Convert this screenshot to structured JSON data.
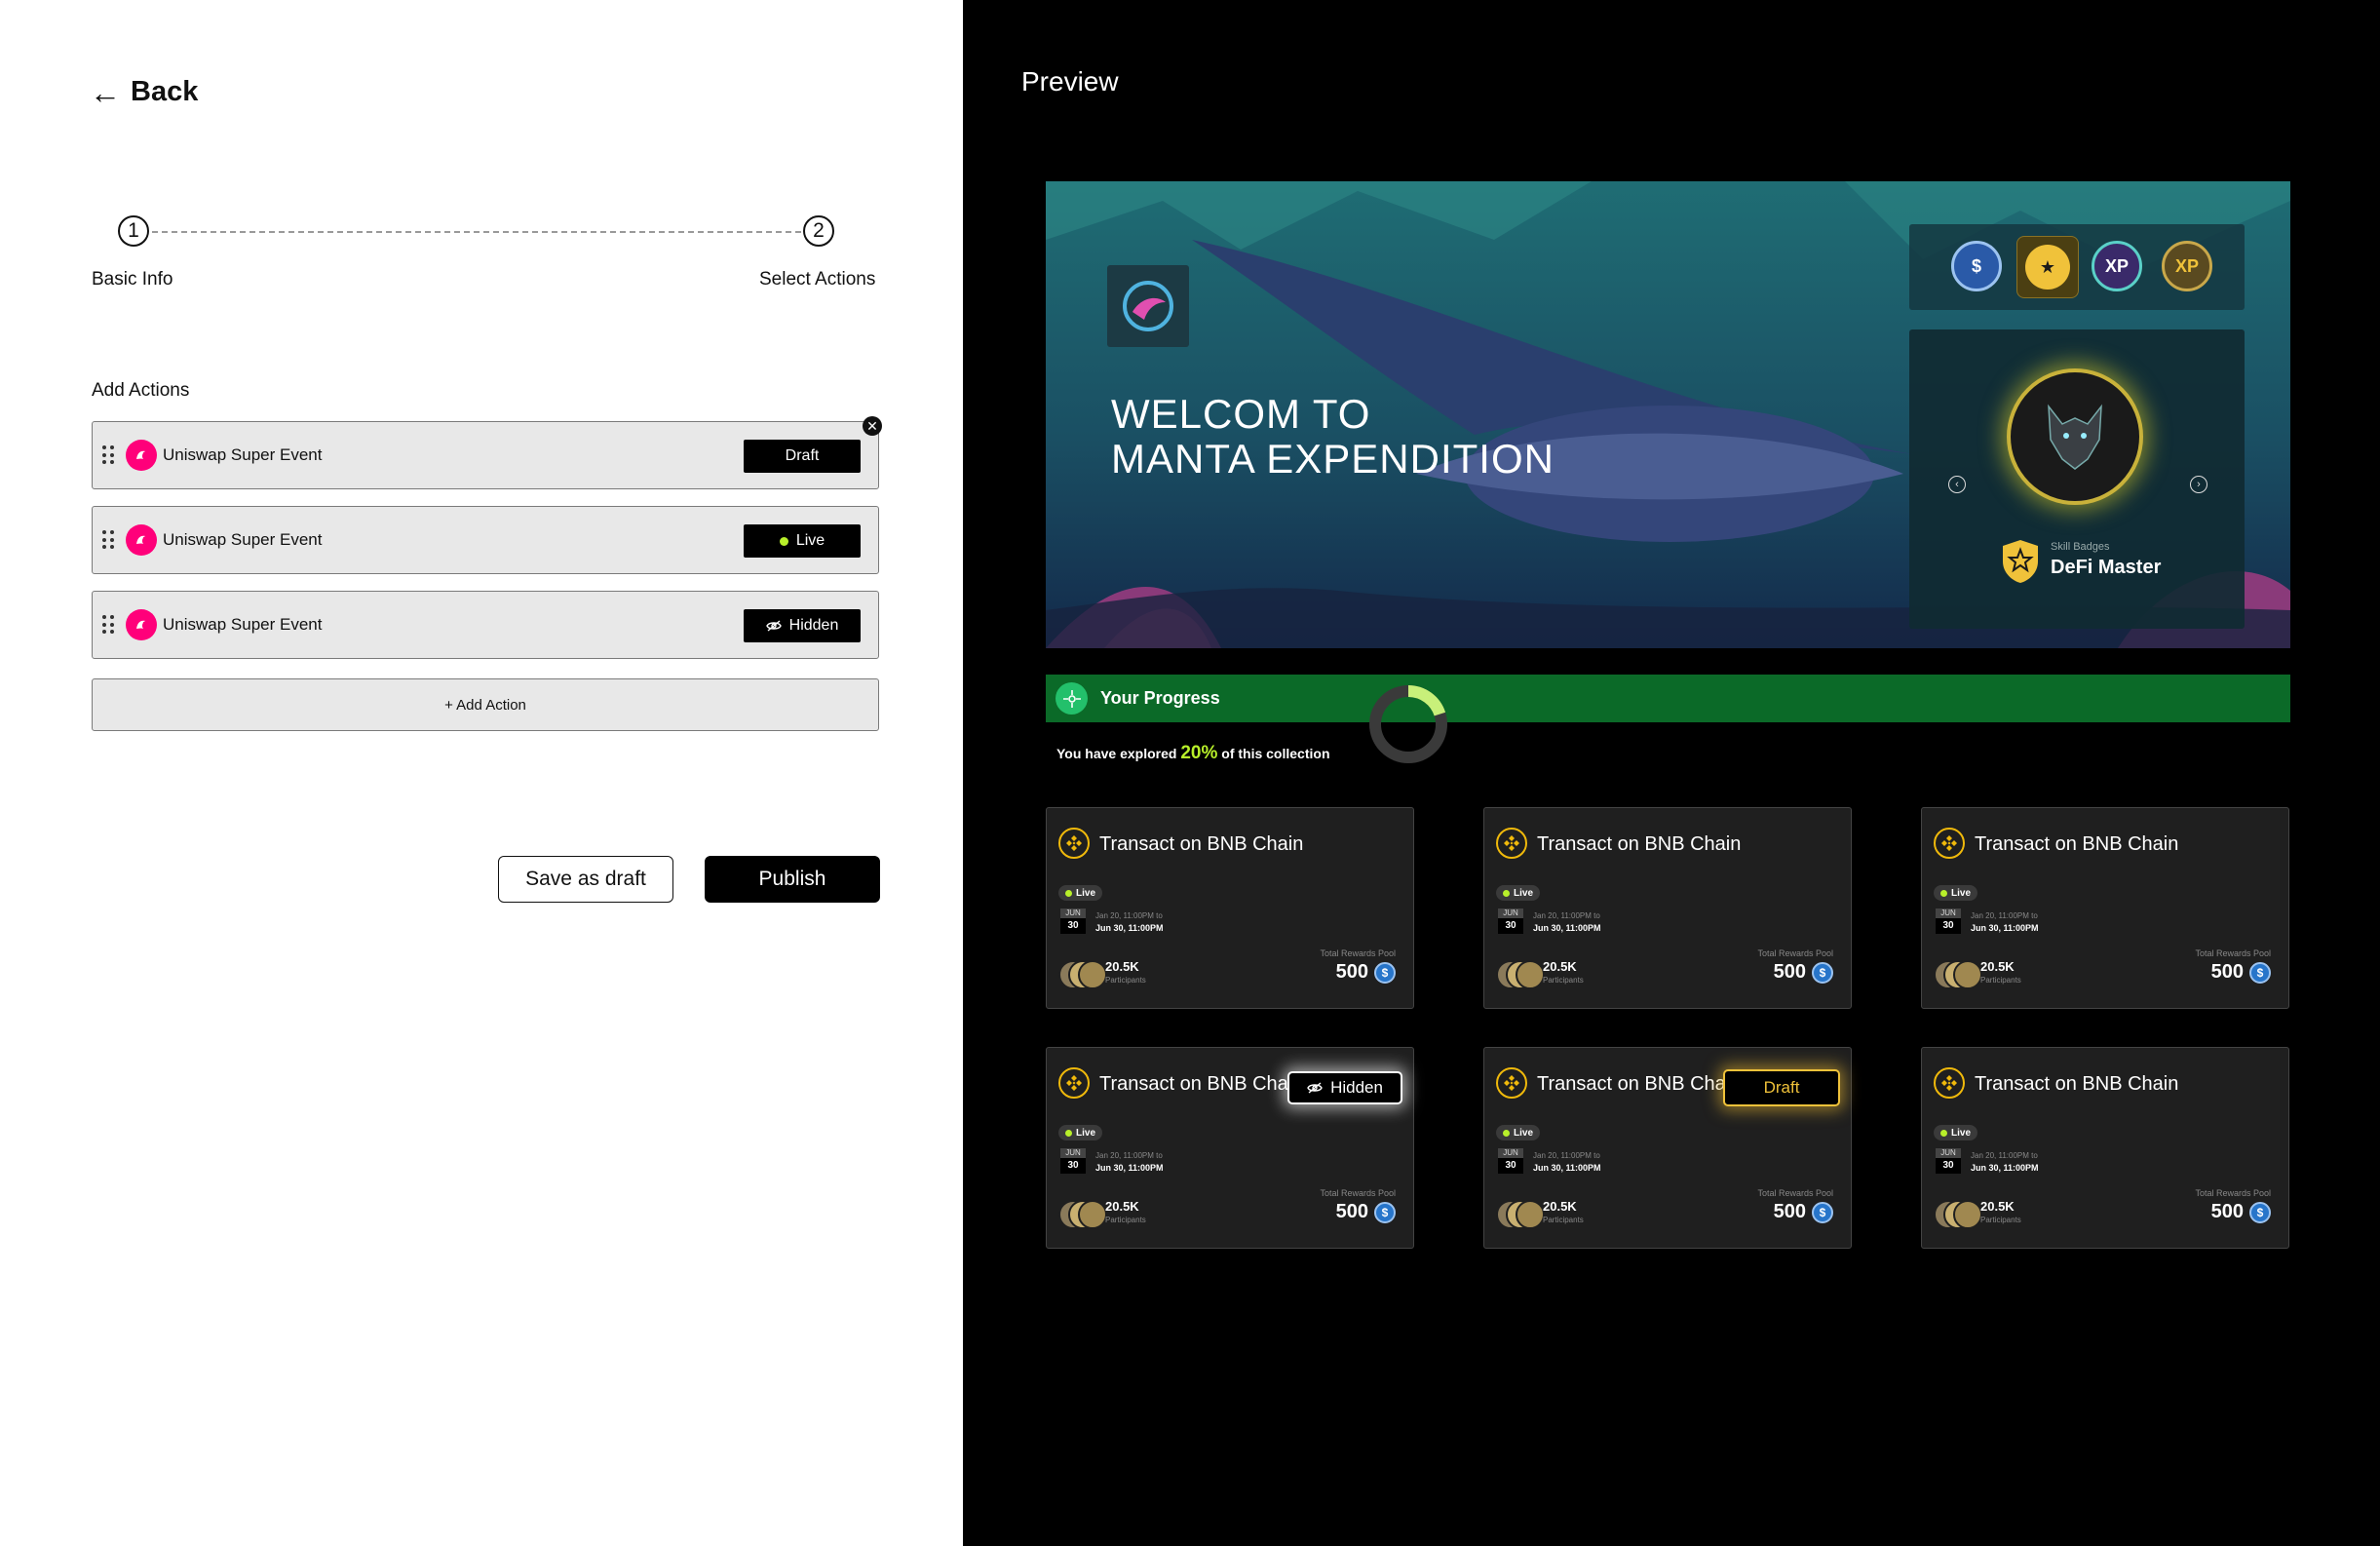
{
  "nav": {
    "back_label": "Back"
  },
  "stepper": {
    "steps": [
      {
        "number": "1",
        "label": "Basic Info"
      },
      {
        "number": "2",
        "label": "Select Actions"
      }
    ]
  },
  "actions": {
    "section_title": "Add Actions",
    "items": [
      {
        "label": "Uniswap Super Event",
        "status": "Draft"
      },
      {
        "label": "Uniswap Super Event",
        "status": "Live"
      },
      {
        "label": "Uniswap Super Event",
        "status": "Hidden"
      }
    ],
    "add_label": "+ Add Action"
  },
  "footer": {
    "save_draft_label": "Save as draft",
    "publish_label": "Publish"
  },
  "preview": {
    "title": "Preview",
    "banner": {
      "title_line1": "WELCOM TO",
      "title_line2": "MANTA EXPENDITION",
      "badges": [
        "$",
        "★",
        "XP",
        "XP"
      ],
      "skill_small": "Skill Badges",
      "skill_name": "DeFi Master"
    },
    "progress": {
      "title": "Your Progress",
      "text_before": "You have explored ",
      "percent": "20%",
      "text_after": " of this collection",
      "fraction": 0.2
    },
    "cards": [
      {
        "title": "Transact on BNB Chain",
        "live": "Live",
        "month": "JUN",
        "day": "30",
        "date_range": "Jan 20, 11:00PM to",
        "date_end": "Jun 30, 11:00PM",
        "participants": "20.5K",
        "participants_label": "Participants",
        "pool_label": "Total Rewards Pool",
        "pool": "500",
        "overlay": ""
      },
      {
        "title": "Transact on BNB Chain",
        "live": "Live",
        "month": "JUN",
        "day": "30",
        "date_range": "Jan 20, 11:00PM to",
        "date_end": "Jun 30, 11:00PM",
        "participants": "20.5K",
        "participants_label": "Participants",
        "pool_label": "Total Rewards Pool",
        "pool": "500",
        "overlay": ""
      },
      {
        "title": "Transact on BNB Chain",
        "live": "Live",
        "month": "JUN",
        "day": "30",
        "date_range": "Jan 20, 11:00PM to",
        "date_end": "Jun 30, 11:00PM",
        "participants": "20.5K",
        "participants_label": "Participants",
        "pool_label": "Total Rewards Pool",
        "pool": "500",
        "overlay": ""
      },
      {
        "title": "Transact on BNB Chain",
        "live": "Live",
        "month": "JUN",
        "day": "30",
        "date_range": "Jan 20, 11:00PM to",
        "date_end": "Jun 30, 11:00PM",
        "participants": "20.5K",
        "participants_label": "Participants",
        "pool_label": "Total Rewards Pool",
        "pool": "500",
        "overlay": "Hidden"
      },
      {
        "title": "Transact on BNB Chain",
        "live": "Live",
        "month": "JUN",
        "day": "30",
        "date_range": "Jan 20, 11:00PM to",
        "date_end": "Jun 30, 11:00PM",
        "participants": "20.5K",
        "participants_label": "Participants",
        "pool_label": "Total Rewards Pool",
        "pool": "500",
        "overlay": "Draft"
      },
      {
        "title": "Transact on BNB Chain",
        "live": "Live",
        "month": "JUN",
        "day": "30",
        "date_range": "Jan 20, 11:00PM to",
        "date_end": "Jun 30, 11:00PM",
        "participants": "20.5K",
        "participants_label": "Participants",
        "pool_label": "Total Rewards Pool",
        "pool": "500",
        "overlay": ""
      }
    ]
  },
  "colors": {
    "accent_green": "#b8f02a",
    "progress_bg": "#0b6a28",
    "uniswap_pink": "#ff007a",
    "bnb_gold": "#f0b90b",
    "draft_gold": "#f0c23a"
  }
}
